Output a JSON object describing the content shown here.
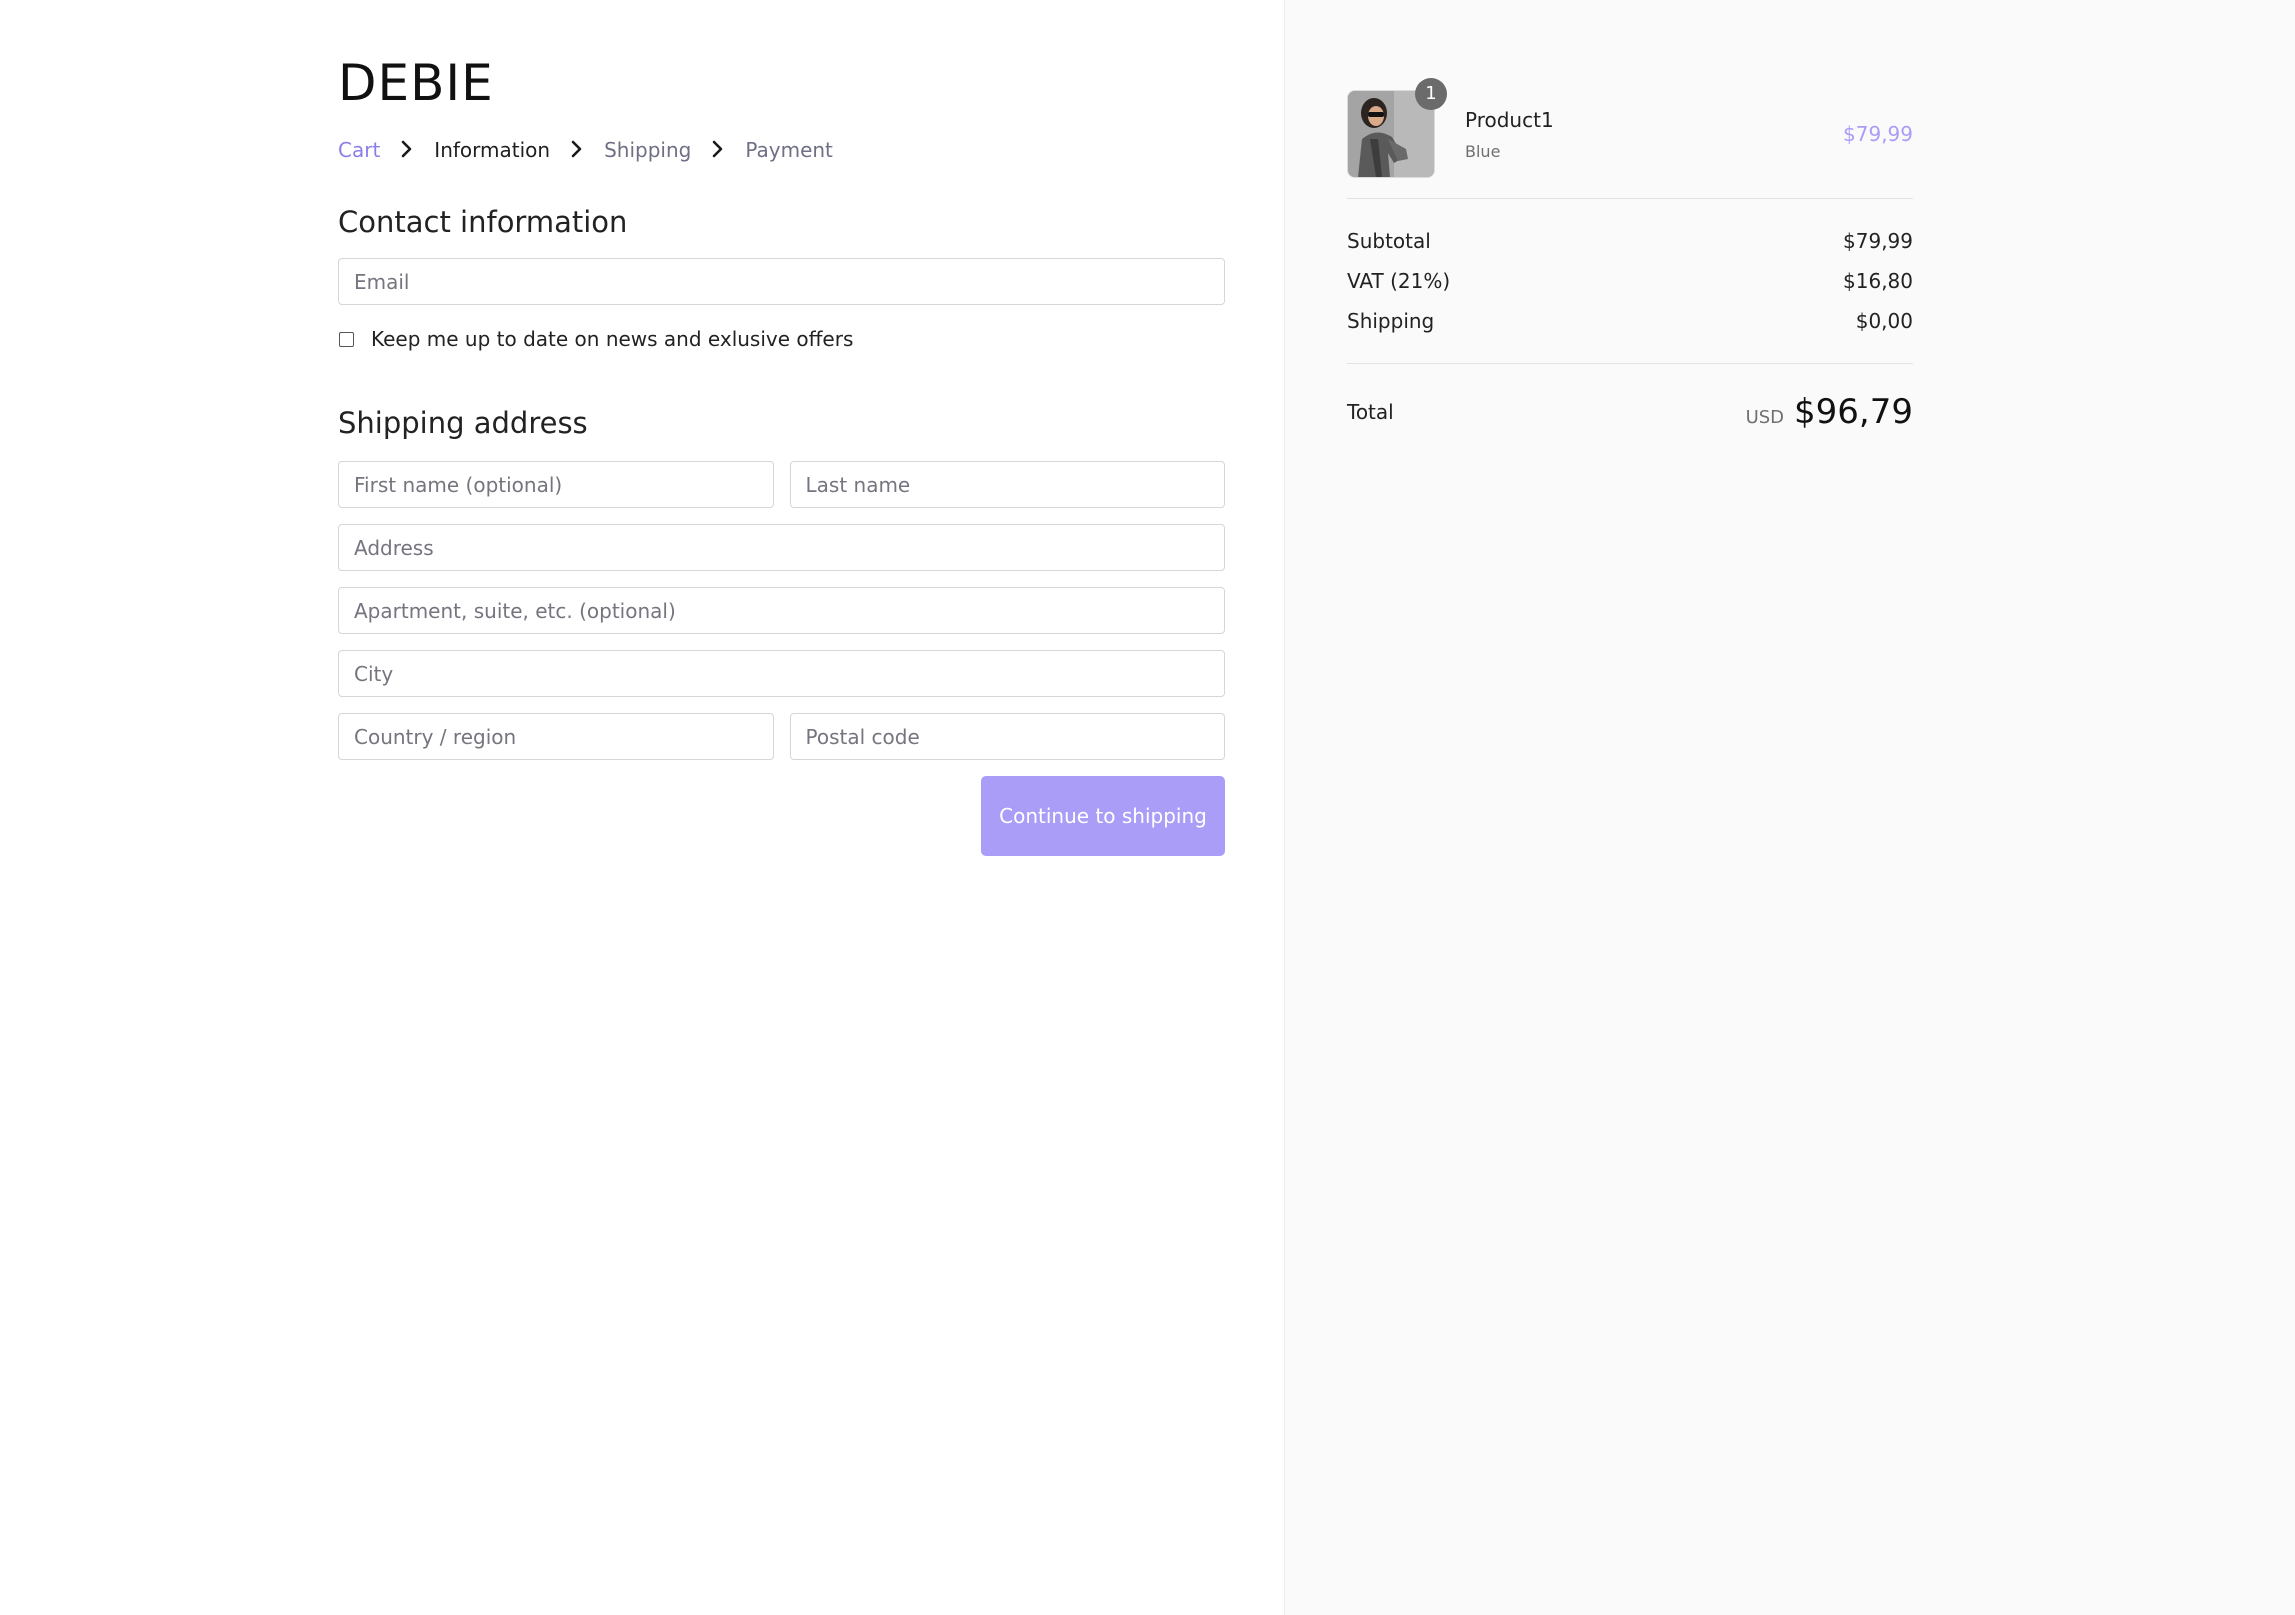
{
  "brand": {
    "name": "DEBIE"
  },
  "breadcrumb": {
    "items": [
      {
        "label": "Cart"
      },
      {
        "label": "Information"
      },
      {
        "label": "Shipping"
      },
      {
        "label": "Payment"
      }
    ]
  },
  "contact": {
    "title": "Contact information",
    "email_placeholder": "Email",
    "newsletter_label": "Keep me up to date on news and exlusive offers"
  },
  "shipping": {
    "title": "Shipping address",
    "first_name_placeholder": "First name (optional)",
    "last_name_placeholder": "Last name",
    "address_placeholder": "Address",
    "apartment_placeholder": "Apartment, suite, etc. (optional)",
    "city_placeholder": "City",
    "country_placeholder": "Country / region",
    "postal_placeholder": "Postal code",
    "continue_label": "Continue to shipping"
  },
  "summary": {
    "product": {
      "name": "Product1",
      "variant": "Blue",
      "price": "$79,99",
      "quantity": "1"
    },
    "subtotal_label": "Subtotal",
    "subtotal_value": "$79,99",
    "vat_label": "VAT (21%)",
    "vat_value": "$16,80",
    "shipping_label": "Shipping",
    "shipping_value": "$0,00",
    "total_label": "Total",
    "currency": "USD",
    "total_value": "$96,79"
  },
  "colors": {
    "accent": "#a99df7",
    "link": "#8a7fe8",
    "sidebar_bg": "#fafafa",
    "badge": "#6b6b6b"
  },
  "icons": {
    "breadcrumb_separator": "chevron-right-icon"
  }
}
